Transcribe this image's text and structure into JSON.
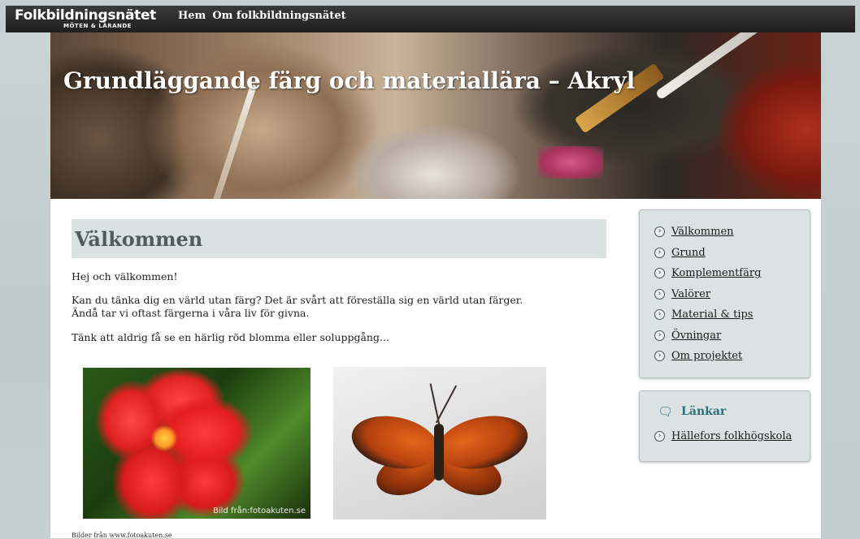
{
  "brand": {
    "name": "Folkbildningsnätet",
    "tagline": "MÖTEN & LÄRANDE"
  },
  "nav": [
    {
      "label": "Hem"
    },
    {
      "label": "Om folkbildningsnätet"
    }
  ],
  "banner": {
    "title": "Grundläggande färg och materiallära – Akryl"
  },
  "main": {
    "heading": "Välkommen",
    "paragraphs": [
      "Hej och välkommen!",
      "Kan du tänka dig en värld utan färg? Det är svårt att föreställa sig en värld utan färger.",
      "Ändå tar vi oftast färgerna i våra liv för givna.",
      "Tänk att aldrig få se en härlig röd blomma eller soluppgång..."
    ],
    "photo_credit": "Bild från:fotoakuten.se",
    "caption": "Bilder från www.fotoakuten.se"
  },
  "sidebar": {
    "menu": [
      {
        "label": "Välkommen"
      },
      {
        "label": "Grund"
      },
      {
        "label": "Komplementfärg"
      },
      {
        "label": "Valörer"
      },
      {
        "label": "Material & tips"
      },
      {
        "label": "Övningar"
      },
      {
        "label": "Om projektet"
      }
    ],
    "links_title": "Länkar",
    "links": [
      {
        "label": "Hällefors folkhögskola"
      }
    ]
  }
}
